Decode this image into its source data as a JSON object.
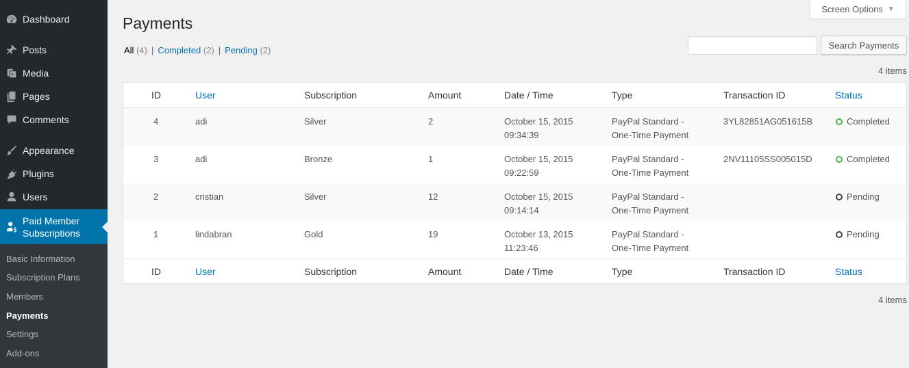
{
  "sidebar": {
    "items": [
      {
        "label": "Dashboard",
        "icon": "dashboard-icon"
      },
      {
        "label": "Posts",
        "icon": "pin-icon"
      },
      {
        "label": "Media",
        "icon": "media-icon"
      },
      {
        "label": "Pages",
        "icon": "pages-icon"
      },
      {
        "label": "Comments",
        "icon": "comment-icon"
      },
      {
        "label": "Appearance",
        "icon": "brush-icon"
      },
      {
        "label": "Plugins",
        "icon": "plugin-icon"
      },
      {
        "label": "Users",
        "icon": "user-icon"
      },
      {
        "label": "Paid Member Subscriptions",
        "icon": "member-dollar-icon"
      }
    ],
    "submenu": [
      "Basic Information",
      "Subscription Plans",
      "Members",
      "Payments",
      "Settings",
      "Add-ons"
    ],
    "current_submenu": "Payments"
  },
  "screen_options": {
    "label": "Screen Options"
  },
  "page": {
    "title": "Payments"
  },
  "filters": {
    "all": {
      "label": "All",
      "count": "(4)"
    },
    "completed": {
      "label": "Completed",
      "count": "(2)"
    },
    "pending": {
      "label": "Pending",
      "count": "(2)"
    },
    "separator": "|"
  },
  "search": {
    "placeholder": "",
    "button_label": "Search Payments"
  },
  "items_count": "4 items",
  "table": {
    "columns": [
      "ID",
      "User",
      "Subscription",
      "Amount",
      "Date / Time",
      "Type",
      "Transaction ID",
      "Status"
    ],
    "rows": [
      {
        "id": "4",
        "user": "adi",
        "subscription": "Silver",
        "amount": "2",
        "date": "October 15, 2015",
        "time": "09:34:39",
        "type1": "PayPal Standard -",
        "type2": "One-Time Payment",
        "transaction": "3YL82851AG051615B",
        "status": "Completed"
      },
      {
        "id": "3",
        "user": "adi",
        "subscription": "Bronze",
        "amount": "1",
        "date": "October 15, 2015",
        "time": "09:22:59",
        "type1": "PayPal Standard -",
        "type2": "One-Time Payment",
        "transaction": "2NV11105SS005015D",
        "status": "Completed"
      },
      {
        "id": "2",
        "user": "cristian",
        "subscription": "Silver",
        "amount": "12",
        "date": "October 15, 2015",
        "time": "09:14:14",
        "type1": "PayPal Standard -",
        "type2": "One-Time Payment",
        "transaction": "",
        "status": "Pending"
      },
      {
        "id": "1",
        "user": "lindabran",
        "subscription": "Gold",
        "amount": "19",
        "date": "October 13, 2015",
        "time": "11:23:46",
        "type1": "PayPal Standard -",
        "type2": "One-Time Payment",
        "transaction": "",
        "status": "Pending"
      }
    ]
  },
  "colors": {
    "sidebar_bg": "#23282d",
    "submenu_bg": "#32373c",
    "accent": "#0073aa",
    "completed": "#46b450",
    "pending": "#444444"
  }
}
